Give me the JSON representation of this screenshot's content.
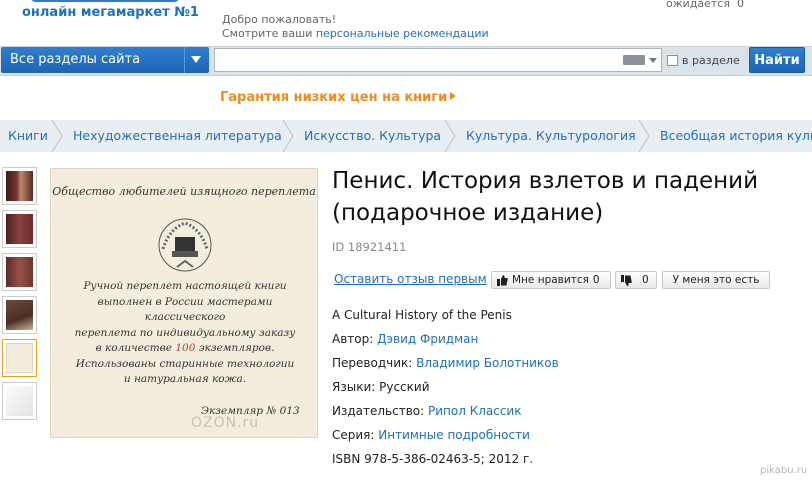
{
  "header": {
    "tagline": "онлайн мегамаркет №1",
    "welcome": "Добро пожаловать!",
    "recommend_prefix": "Смотрите ваши ",
    "recommend_link": "персональные рекомендации",
    "cart_text": "ожидается",
    "cart_count": "0"
  },
  "search": {
    "sections_label": "Все разделы сайта",
    "query": "",
    "in_section_label": "в разделе",
    "find_label": "Найти"
  },
  "promo": {
    "text": "Гарантия низких цен на книги"
  },
  "breadcrumbs": [
    {
      "label": "Книги"
    },
    {
      "label": "Нехудожественная литература"
    },
    {
      "label": "Искусство. Культура"
    },
    {
      "label": "Культура. Культурология"
    },
    {
      "label": "Всеобщая история культуры"
    }
  ],
  "cover": {
    "top_text": "Общество любителей изящного переплета",
    "body_lines": [
      "Ручной переплет настоящей книги",
      "выполнен в России мастерами классического",
      "переплета по индивидуальному заказу"
    ],
    "count_prefix": "в количестве ",
    "count_value": "100",
    "count_suffix": " экземпляров.",
    "tail_lines": [
      "Использованы старинные технологии",
      "и натуральная кожа."
    ],
    "sign": "Экземпляр № 013",
    "watermark": "OZON.ru"
  },
  "product": {
    "title_line1": "Пенис. История взлетов и падений",
    "title_line2": "(подарочное издание)",
    "id_text": "ID 18921411",
    "review_link": "Оставить отзыв первым",
    "like_label": "Мне нравится",
    "like_count": "0",
    "dislike_count": "0",
    "have_label": "У меня это есть",
    "original_title": "A Cultural History of the Penis",
    "author_label": "Автор: ",
    "author": "Дэвид Фридман",
    "translator_label": "Переводчик: ",
    "translator": "Владимир Болотников",
    "languages_label": "Языки: ",
    "languages": "Русский",
    "publisher_label": "Издательство: ",
    "publisher": "Рипол Классик",
    "series_label": "Серия: ",
    "series": "Интимные подробности",
    "isbn": "ISBN 978-5-386-02463-5; 2012 г."
  },
  "site_watermark": "pikabu.ru"
}
